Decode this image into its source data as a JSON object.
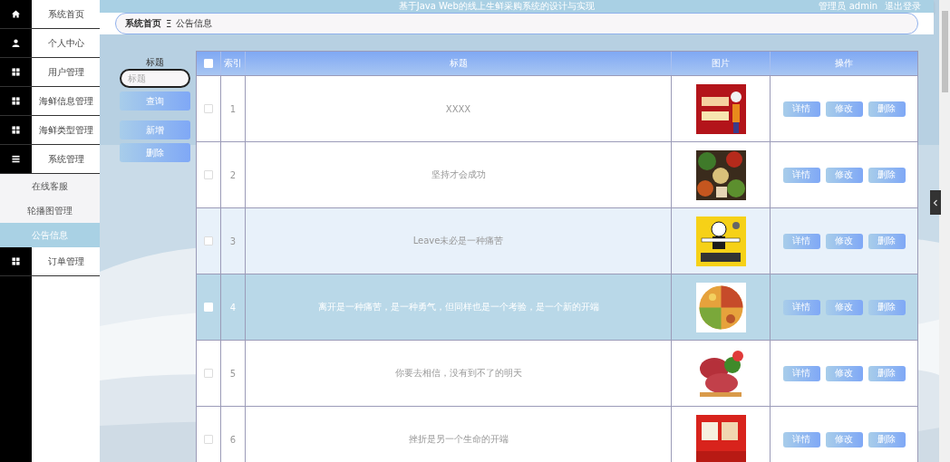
{
  "sidebar": {
    "items": [
      {
        "label": "系统首页",
        "kind": "home",
        "selected": false
      },
      {
        "label": "个人中心",
        "kind": "user",
        "selected": false
      },
      {
        "label": "用户管理",
        "kind": "grid",
        "selected": false
      },
      {
        "label": "海鲜信息管理",
        "kind": "grid",
        "selected": false
      },
      {
        "label": "海鲜类型管理",
        "kind": "grid",
        "selected": false
      },
      {
        "label": "系统管理",
        "kind": "menu",
        "selected": false,
        "children": [
          {
            "label": "在线客服",
            "selected": false
          },
          {
            "label": "轮播图管理",
            "selected": false
          },
          {
            "label": "公告信息",
            "selected": true
          }
        ]
      },
      {
        "label": "订单管理",
        "kind": "grid",
        "selected": false
      }
    ]
  },
  "header": {
    "title": "基于Java Web的线上生鲜采购系统的设计与实现",
    "user": "管理员 admin",
    "logout": "退出登录"
  },
  "breadcrumb": {
    "items": [
      "系统首页",
      "公告信息"
    ],
    "separator": "Ξ"
  },
  "search": {
    "label": "标题",
    "placeholder": "标题",
    "buttons": [
      "查询",
      "新增",
      "删除"
    ]
  },
  "table": {
    "header_checked": false,
    "columns": [
      "索引",
      "标题",
      "图片",
      "操作"
    ],
    "rows": [
      {
        "index": "1",
        "title": "XXXX",
        "checked": false,
        "selected": false,
        "highlighted": false,
        "actions": [
          "详情",
          "修改",
          "删除"
        ]
      },
      {
        "index": "2",
        "title": "坚持才会成功",
        "checked": false,
        "selected": false,
        "highlighted": false,
        "actions": [
          "详情",
          "修改",
          "删除"
        ]
      },
      {
        "index": "3",
        "title": "Leave未必是一种痛苦",
        "checked": false,
        "selected": false,
        "highlighted": true,
        "actions": [
          "详情",
          "修改",
          "删除"
        ]
      },
      {
        "index": "4",
        "title": "离开是一种痛苦，是一种勇气，但同样也是一个考验，是一个新的开端",
        "checked": false,
        "selected": true,
        "highlighted": false,
        "actions": [
          "详情",
          "修改",
          "删除"
        ]
      },
      {
        "index": "5",
        "title": "你要去相信，没有到不了的明天",
        "checked": false,
        "selected": false,
        "highlighted": false,
        "actions": [
          "详情",
          "修改",
          "删除"
        ]
      },
      {
        "index": "6",
        "title": "挫折是另一个生命的开端",
        "checked": false,
        "selected": false,
        "highlighted": false,
        "actions": [
          "详情",
          "修改",
          "删除"
        ]
      }
    ]
  }
}
